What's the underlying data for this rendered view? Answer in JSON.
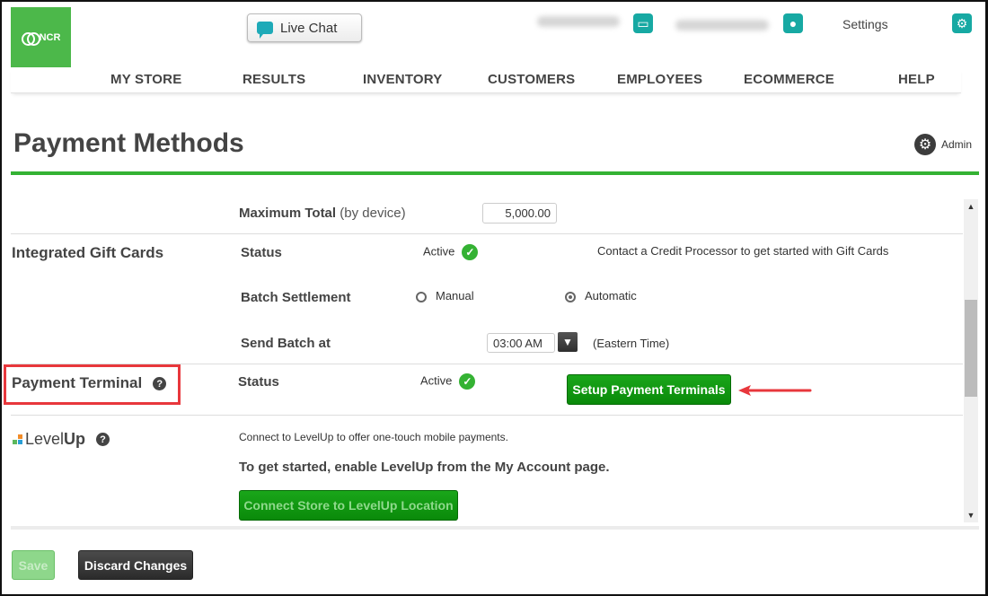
{
  "header": {
    "logo_text": "NCR",
    "live_chat_label": "Live Chat",
    "settings_label": "Settings"
  },
  "nav": {
    "items": [
      "MY STORE",
      "RESULTS",
      "INVENTORY",
      "CUSTOMERS",
      "EMPLOYEES",
      "ECOMMERCE",
      "HELP"
    ]
  },
  "page": {
    "title": "Payment Methods",
    "admin_label": "Admin"
  },
  "max_total": {
    "label": "Maximum Total",
    "suffix": "(by device)",
    "value": "5,000.00"
  },
  "gift_cards": {
    "section_label": "Integrated Gift Cards",
    "status_label": "Status",
    "status_value": "Active",
    "note": "Contact a Credit Processor to get started with Gift Cards",
    "batch_label": "Batch Settlement",
    "batch_options": [
      "Manual",
      "Automatic"
    ],
    "batch_selected": "Automatic",
    "send_batch_label": "Send Batch at",
    "send_batch_time": "03:00 AM",
    "timezone": "(Eastern Time)"
  },
  "payment_terminal": {
    "section_label": "Payment Terminal",
    "status_label": "Status",
    "status_value": "Active",
    "setup_button": "Setup Payment Terminals"
  },
  "levelup": {
    "brand_light": "Level",
    "brand_bold": "Up",
    "description": "Connect to LevelUp to offer one-touch mobile payments.",
    "instruction": "To get started, enable LevelUp from the My Account page.",
    "connect_button": "Connect Store to LevelUp Location"
  },
  "footer": {
    "save_label": "Save",
    "discard_label": "Discard Changes"
  },
  "colors": {
    "brand_green": "#4cb84a",
    "accent_teal": "#17a9a3",
    "highlight_red": "#e8373c"
  }
}
